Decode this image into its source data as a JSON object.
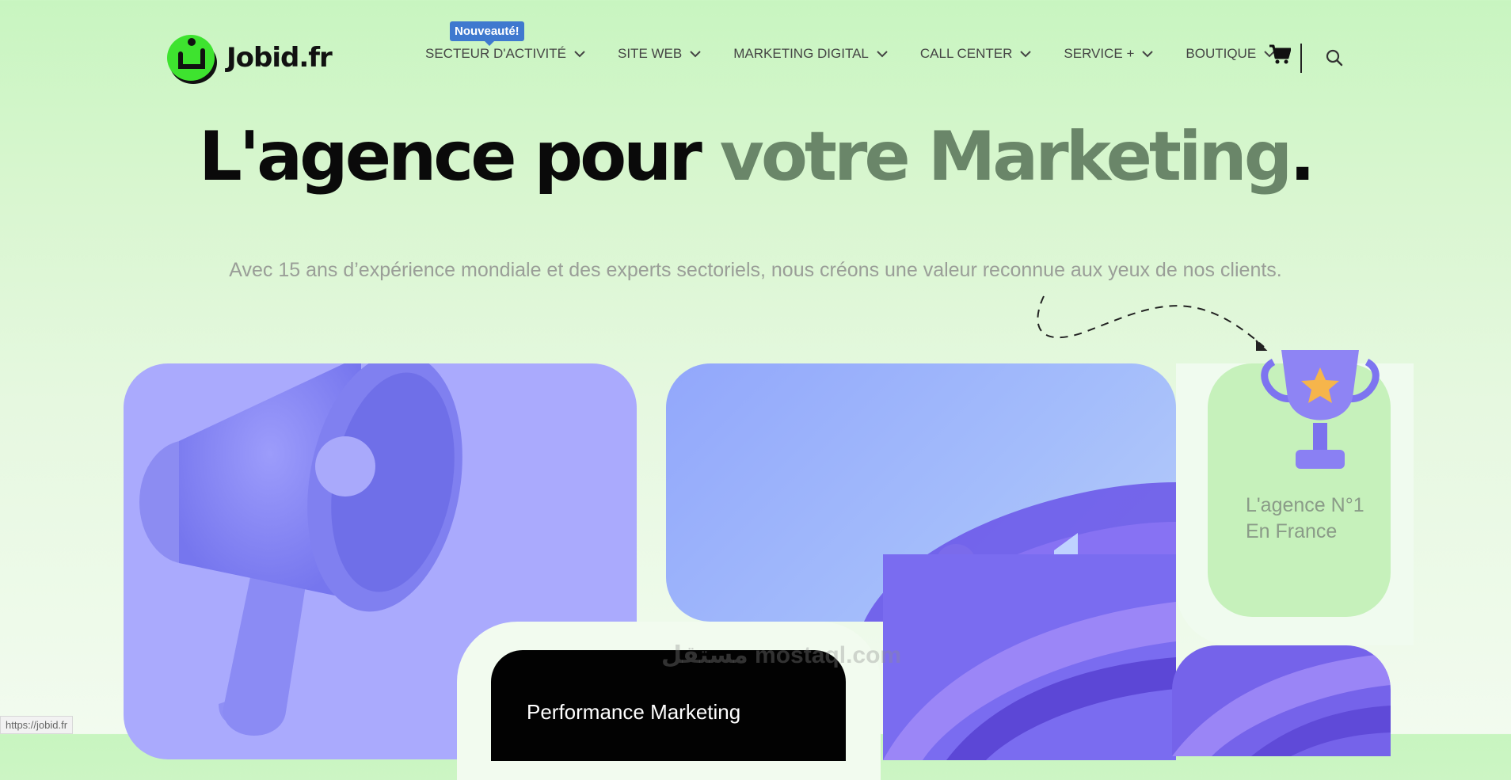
{
  "brand": {
    "name": "Jobid.fr"
  },
  "nav": {
    "badge": "Nouveauté!",
    "items": [
      {
        "label": "SECTEUR D'ACTIVITÉ"
      },
      {
        "label": "SITE WEB"
      },
      {
        "label": "MARKETING DIGITAL"
      },
      {
        "label": "CALL CENTER"
      },
      {
        "label": "SERVICE +"
      },
      {
        "label": "BOUTIQUE"
      }
    ],
    "cart_icon": "cart-icon",
    "search_icon": "search-icon"
  },
  "hero": {
    "title_dark": "L'agence pour ",
    "title_accent": "votre Marketing",
    "title_dot": ".",
    "subtitle": "Avec 15 ans d’expérience mondiale et des experts sectoriels, nous créons une valeur reconnue aux yeux de nos clients."
  },
  "cards": {
    "trophy_text": "L'agence N°1 En France",
    "black_card_text": "Performance Marketing"
  },
  "status_url": "https://jobid.fr",
  "watermark": "مستقل mostaql.com",
  "colors": {
    "background": "#c8f5c0",
    "accent_text": "#6a8669",
    "badge": "#3f79cf",
    "logo_green": "#3ee32f",
    "card_purple": "#aaaafd",
    "card_blue": "#92a7fb",
    "card_green": "#c6f1bb"
  }
}
